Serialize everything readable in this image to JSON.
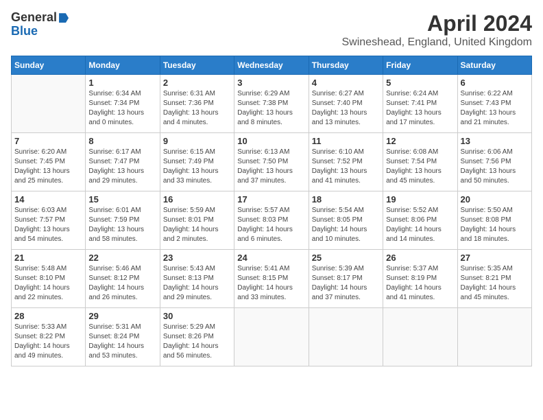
{
  "header": {
    "logo_general": "General",
    "logo_blue": "Blue",
    "month_title": "April 2024",
    "subtitle": "Swineshead, England, United Kingdom"
  },
  "days_of_week": [
    "Sunday",
    "Monday",
    "Tuesday",
    "Wednesday",
    "Thursday",
    "Friday",
    "Saturday"
  ],
  "weeks": [
    [
      {
        "day": "",
        "info": []
      },
      {
        "day": "1",
        "info": [
          "Sunrise: 6:34 AM",
          "Sunset: 7:34 PM",
          "Daylight: 13 hours",
          "and 0 minutes."
        ]
      },
      {
        "day": "2",
        "info": [
          "Sunrise: 6:31 AM",
          "Sunset: 7:36 PM",
          "Daylight: 13 hours",
          "and 4 minutes."
        ]
      },
      {
        "day": "3",
        "info": [
          "Sunrise: 6:29 AM",
          "Sunset: 7:38 PM",
          "Daylight: 13 hours",
          "and 8 minutes."
        ]
      },
      {
        "day": "4",
        "info": [
          "Sunrise: 6:27 AM",
          "Sunset: 7:40 PM",
          "Daylight: 13 hours",
          "and 13 minutes."
        ]
      },
      {
        "day": "5",
        "info": [
          "Sunrise: 6:24 AM",
          "Sunset: 7:41 PM",
          "Daylight: 13 hours",
          "and 17 minutes."
        ]
      },
      {
        "day": "6",
        "info": [
          "Sunrise: 6:22 AM",
          "Sunset: 7:43 PM",
          "Daylight: 13 hours",
          "and 21 minutes."
        ]
      }
    ],
    [
      {
        "day": "7",
        "info": [
          "Sunrise: 6:20 AM",
          "Sunset: 7:45 PM",
          "Daylight: 13 hours",
          "and 25 minutes."
        ]
      },
      {
        "day": "8",
        "info": [
          "Sunrise: 6:17 AM",
          "Sunset: 7:47 PM",
          "Daylight: 13 hours",
          "and 29 minutes."
        ]
      },
      {
        "day": "9",
        "info": [
          "Sunrise: 6:15 AM",
          "Sunset: 7:49 PM",
          "Daylight: 13 hours",
          "and 33 minutes."
        ]
      },
      {
        "day": "10",
        "info": [
          "Sunrise: 6:13 AM",
          "Sunset: 7:50 PM",
          "Daylight: 13 hours",
          "and 37 minutes."
        ]
      },
      {
        "day": "11",
        "info": [
          "Sunrise: 6:10 AM",
          "Sunset: 7:52 PM",
          "Daylight: 13 hours",
          "and 41 minutes."
        ]
      },
      {
        "day": "12",
        "info": [
          "Sunrise: 6:08 AM",
          "Sunset: 7:54 PM",
          "Daylight: 13 hours",
          "and 45 minutes."
        ]
      },
      {
        "day": "13",
        "info": [
          "Sunrise: 6:06 AM",
          "Sunset: 7:56 PM",
          "Daylight: 13 hours",
          "and 50 minutes."
        ]
      }
    ],
    [
      {
        "day": "14",
        "info": [
          "Sunrise: 6:03 AM",
          "Sunset: 7:57 PM",
          "Daylight: 13 hours",
          "and 54 minutes."
        ]
      },
      {
        "day": "15",
        "info": [
          "Sunrise: 6:01 AM",
          "Sunset: 7:59 PM",
          "Daylight: 13 hours",
          "and 58 minutes."
        ]
      },
      {
        "day": "16",
        "info": [
          "Sunrise: 5:59 AM",
          "Sunset: 8:01 PM",
          "Daylight: 14 hours",
          "and 2 minutes."
        ]
      },
      {
        "day": "17",
        "info": [
          "Sunrise: 5:57 AM",
          "Sunset: 8:03 PM",
          "Daylight: 14 hours",
          "and 6 minutes."
        ]
      },
      {
        "day": "18",
        "info": [
          "Sunrise: 5:54 AM",
          "Sunset: 8:05 PM",
          "Daylight: 14 hours",
          "and 10 minutes."
        ]
      },
      {
        "day": "19",
        "info": [
          "Sunrise: 5:52 AM",
          "Sunset: 8:06 PM",
          "Daylight: 14 hours",
          "and 14 minutes."
        ]
      },
      {
        "day": "20",
        "info": [
          "Sunrise: 5:50 AM",
          "Sunset: 8:08 PM",
          "Daylight: 14 hours",
          "and 18 minutes."
        ]
      }
    ],
    [
      {
        "day": "21",
        "info": [
          "Sunrise: 5:48 AM",
          "Sunset: 8:10 PM",
          "Daylight: 14 hours",
          "and 22 minutes."
        ]
      },
      {
        "day": "22",
        "info": [
          "Sunrise: 5:46 AM",
          "Sunset: 8:12 PM",
          "Daylight: 14 hours",
          "and 26 minutes."
        ]
      },
      {
        "day": "23",
        "info": [
          "Sunrise: 5:43 AM",
          "Sunset: 8:13 PM",
          "Daylight: 14 hours",
          "and 29 minutes."
        ]
      },
      {
        "day": "24",
        "info": [
          "Sunrise: 5:41 AM",
          "Sunset: 8:15 PM",
          "Daylight: 14 hours",
          "and 33 minutes."
        ]
      },
      {
        "day": "25",
        "info": [
          "Sunrise: 5:39 AM",
          "Sunset: 8:17 PM",
          "Daylight: 14 hours",
          "and 37 minutes."
        ]
      },
      {
        "day": "26",
        "info": [
          "Sunrise: 5:37 AM",
          "Sunset: 8:19 PM",
          "Daylight: 14 hours",
          "and 41 minutes."
        ]
      },
      {
        "day": "27",
        "info": [
          "Sunrise: 5:35 AM",
          "Sunset: 8:21 PM",
          "Daylight: 14 hours",
          "and 45 minutes."
        ]
      }
    ],
    [
      {
        "day": "28",
        "info": [
          "Sunrise: 5:33 AM",
          "Sunset: 8:22 PM",
          "Daylight: 14 hours",
          "and 49 minutes."
        ]
      },
      {
        "day": "29",
        "info": [
          "Sunrise: 5:31 AM",
          "Sunset: 8:24 PM",
          "Daylight: 14 hours",
          "and 53 minutes."
        ]
      },
      {
        "day": "30",
        "info": [
          "Sunrise: 5:29 AM",
          "Sunset: 8:26 PM",
          "Daylight: 14 hours",
          "and 56 minutes."
        ]
      },
      {
        "day": "",
        "info": []
      },
      {
        "day": "",
        "info": []
      },
      {
        "day": "",
        "info": []
      },
      {
        "day": "",
        "info": []
      }
    ]
  ]
}
